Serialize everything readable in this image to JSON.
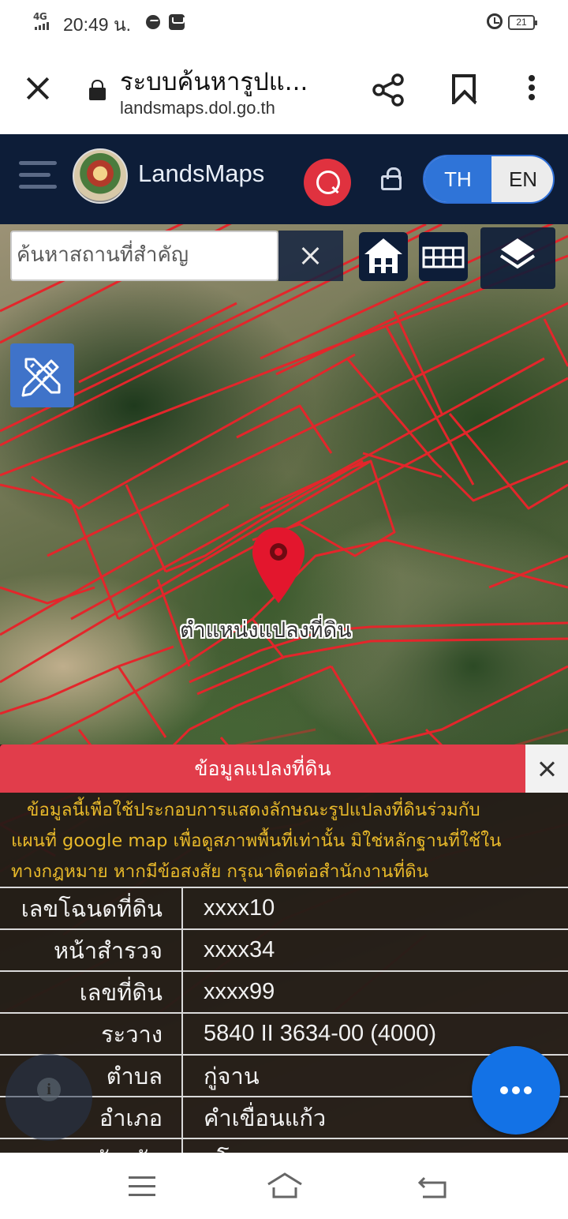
{
  "status_bar": {
    "network": "4G",
    "time": "20:49 น.",
    "battery": "21"
  },
  "browser": {
    "page_title": "ระบบค้นหารูปแ...",
    "url": "landsmaps.dol.go.th"
  },
  "app_header": {
    "brand": "LandsMaps",
    "lang_th": "TH",
    "lang_en": "EN",
    "active_lang": "TH"
  },
  "map": {
    "search_placeholder": "ค้นหาสถานที่สำคัญ",
    "pin_label": "ตำแหน่งแปลงที่ดิน",
    "parcel_line_color": "#e3262b",
    "pin_color": "#e3162d"
  },
  "info_panel": {
    "title": "ข้อมูลแปลงที่ดิน",
    "note_line_1": "ข้อมูลนี้เพื่อใช้ประกอบการแสดงลักษณะรูปแปลงที่ดินร่วมกับ",
    "note_line_2": "แผนที่ google map เพื่อดูสภาพพื้นที่เท่านั้น มิใช่หลักฐานที่ใช้ใน",
    "note_line_3": "ทางกฎหมาย หากมีข้อสงสัย กรุณาติดต่อสำนักงานที่ดิน",
    "rows": [
      {
        "label": "เลขโฉนดที่ดิน",
        "value": "xxxx10"
      },
      {
        "label": "หน้าสำรวจ",
        "value": "xxxx34"
      },
      {
        "label": "เลขที่ดิน",
        "value": "xxxx99"
      },
      {
        "label": "ระวาง",
        "value": "5840 II 3634-00 (4000)"
      },
      {
        "label": "ตำบล",
        "value": "กู่จาน"
      },
      {
        "label": "อำเภอ",
        "value": "คำเขื่อนแก้ว"
      },
      {
        "label": "จังหวัด",
        "value": "ยโสธร"
      }
    ],
    "header_color": "#e13d4b",
    "note_color": "#e8b92a"
  },
  "colors": {
    "header_bg": "#0d1d38",
    "accent_blue": "#2f74d8",
    "search_red": "#e0323f",
    "fab_blue": "#1372e6"
  },
  "icons": [
    "close-icon",
    "lock-icon",
    "share-icon",
    "bookmark-icon",
    "more-vert-icon",
    "hamburger-icon",
    "search-icon",
    "home-icon",
    "grid-icon",
    "layers-icon",
    "draw-tools-icon",
    "map-pin-icon",
    "info-icon",
    "more-horiz-icon",
    "nav-menu-icon",
    "nav-home-icon",
    "nav-back-icon"
  ]
}
